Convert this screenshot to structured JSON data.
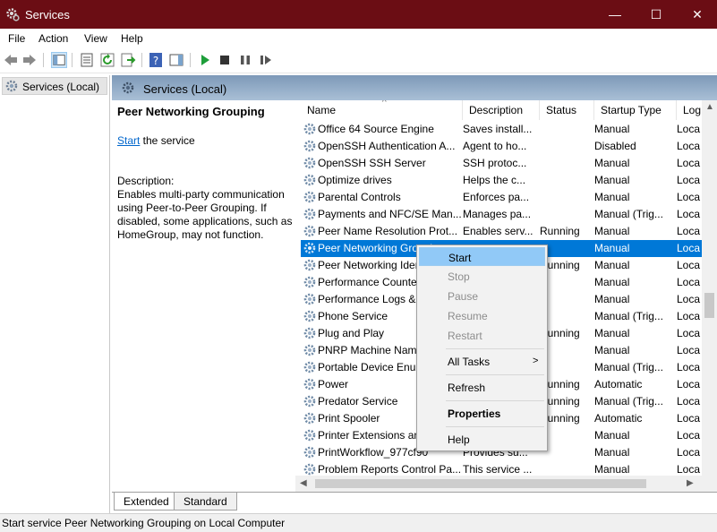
{
  "window": {
    "title": "Services",
    "controls": [
      "—",
      "☐",
      "✕"
    ]
  },
  "menu": [
    "File",
    "Action",
    "View",
    "Help"
  ],
  "tree": {
    "root_label": "Services (Local)"
  },
  "main": {
    "header": "Services (Local)",
    "selected_service": "Peer Networking Grouping",
    "start_link": "Start",
    "start_suffix": " the service",
    "description_label": "Description:",
    "description_text": "Enables multi-party communication using Peer-to-Peer Grouping.  If disabled, some applications, such as HomeGroup, may not function."
  },
  "columns": [
    "Name",
    "Description",
    "Status",
    "Startup Type",
    "Log"
  ],
  "rows": [
    {
      "name": "Office 64 Source Engine",
      "description": "Saves install...",
      "status": "",
      "startup": "Manual",
      "log": "Loca"
    },
    {
      "name": "OpenSSH Authentication A...",
      "description": "Agent to ho...",
      "status": "",
      "startup": "Disabled",
      "log": "Loca"
    },
    {
      "name": "OpenSSH SSH Server",
      "description": "SSH protoc...",
      "status": "",
      "startup": "Manual",
      "log": "Loca"
    },
    {
      "name": "Optimize drives",
      "description": "Helps the c...",
      "status": "",
      "startup": "Manual",
      "log": "Loca"
    },
    {
      "name": "Parental Controls",
      "description": "Enforces pa...",
      "status": "",
      "startup": "Manual",
      "log": "Loca"
    },
    {
      "name": "Payments and NFC/SE Man...",
      "description": "Manages pa...",
      "status": "",
      "startup": "Manual (Trig...",
      "log": "Loca"
    },
    {
      "name": "Peer Name Resolution Prot...",
      "description": "Enables serv...",
      "status": "Running",
      "startup": "Manual",
      "log": "Loca"
    },
    {
      "name": "Peer Networking Grouping",
      "description": "",
      "status": "",
      "startup": "Manual",
      "log": "Loca",
      "selected": true
    },
    {
      "name": "Peer Networking Identity M...",
      "description": "",
      "status": "Running",
      "startup": "Manual",
      "log": "Loca"
    },
    {
      "name": "Performance Counter DLL H...",
      "description": "",
      "status": "",
      "startup": "Manual",
      "log": "Loca"
    },
    {
      "name": "Performance Logs & Alerts",
      "description": "",
      "status": "",
      "startup": "Manual",
      "log": "Loca"
    },
    {
      "name": "Phone Service",
      "description": "",
      "status": "",
      "startup": "Manual (Trig...",
      "log": "Loca"
    },
    {
      "name": "Plug and Play",
      "description": "",
      "status": "Running",
      "startup": "Manual",
      "log": "Loca"
    },
    {
      "name": "PNRP Machine Name Public...",
      "description": "",
      "status": "",
      "startup": "Manual",
      "log": "Loca"
    },
    {
      "name": "Portable Device Enumerator...",
      "description": "",
      "status": "",
      "startup": "Manual (Trig...",
      "log": "Loca"
    },
    {
      "name": "Power",
      "description": "",
      "status": "Running",
      "startup": "Automatic",
      "log": "Loca"
    },
    {
      "name": "Predator Service",
      "description": "",
      "status": "Running",
      "startup": "Manual (Trig...",
      "log": "Loca"
    },
    {
      "name": "Print Spooler",
      "description": "",
      "status": "Running",
      "startup": "Automatic",
      "log": "Loca"
    },
    {
      "name": "Printer Extensions and Noti...",
      "description": "",
      "status": "",
      "startup": "Manual",
      "log": "Loca"
    },
    {
      "name": "PrintWorkflow_977cf90",
      "description": "Provides su...",
      "status": "",
      "startup": "Manual",
      "log": "Loca"
    },
    {
      "name": "Problem Reports Control Pa...",
      "description": "This service ...",
      "status": "",
      "startup": "Manual",
      "log": "Loca"
    }
  ],
  "tabs": [
    "Extended",
    "Standard"
  ],
  "status_bar": "Start service Peer Networking Grouping on Local Computer",
  "context_menu": {
    "start": "Start",
    "stop": "Stop",
    "pause": "Pause",
    "resume": "Resume",
    "restart": "Restart",
    "all_tasks": "All Tasks",
    "refresh": "Refresh",
    "properties": "Properties",
    "help": "Help"
  },
  "colors": {
    "title_bar": "#6b0d14",
    "selection": "#0078d7",
    "menu_highlight": "#91c9f7",
    "link": "#0066cc"
  }
}
